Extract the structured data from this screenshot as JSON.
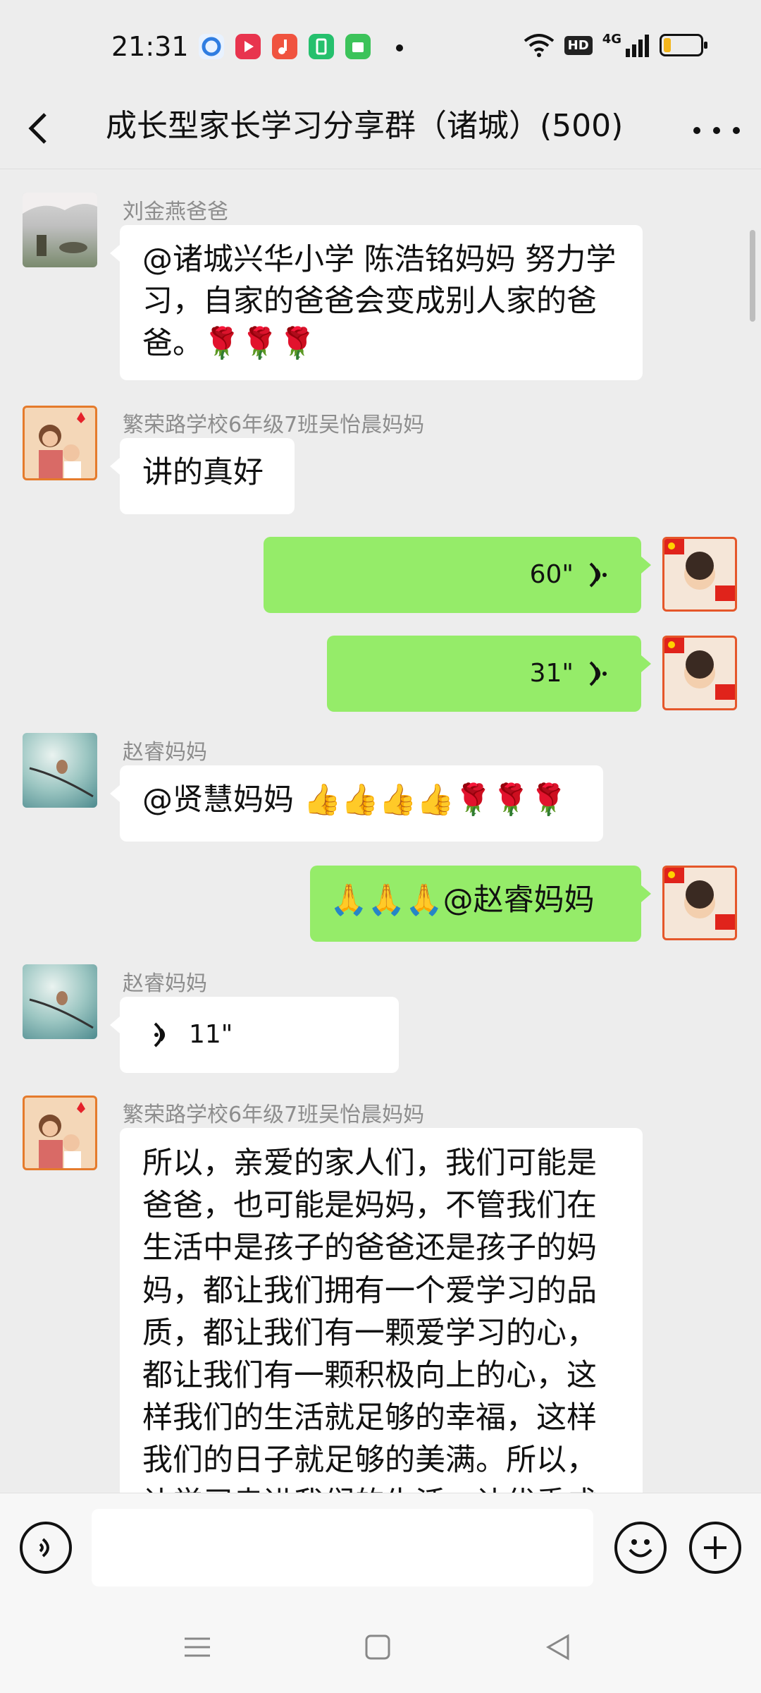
{
  "status_bar": {
    "time": "21:31",
    "network": "4G",
    "hd_label": "HD",
    "battery_percent": 20
  },
  "header": {
    "title": "成长型家长学习分享群（诸城）(500)"
  },
  "messages": [
    {
      "side": "left",
      "sender": "刘金燕爸爸",
      "text": "@诸城兴华小学  陈浩铭妈妈  努力学习，自家的爸爸会变成别人家的爸爸。🌹🌹🌹"
    },
    {
      "side": "left",
      "sender": "繁荣路学校6年级7班吴怡晨妈妈",
      "text": "讲的真好"
    },
    {
      "side": "right",
      "type": "voice",
      "duration": "60\""
    },
    {
      "side": "right",
      "type": "voice",
      "duration": "31\""
    },
    {
      "side": "left",
      "sender": "赵睿妈妈",
      "text": "@贤慧妈妈  👍👍👍👍🌹🌹🌹"
    },
    {
      "side": "right",
      "text": "🙏🙏🙏@赵睿妈妈"
    },
    {
      "side": "left",
      "sender": "赵睿妈妈",
      "type": "voice",
      "duration": "11\""
    },
    {
      "side": "left",
      "sender": "繁荣路学校6年级7班吴怡晨妈妈",
      "text": "所以，亲爱的家人们，我们可能是爸爸，也可能是妈妈，不管我们在生活中是孩子的爸爸还是孩子的妈妈，都让我们拥有一个爱学习的品质，都让我们有一颗爱学习的心，都让我们有一颗积极向上的心，这样我们的生活就足够的幸福，这样我们的日子就足够的美满。所以，让学习走进我们的生活，让优秀成"
    }
  ],
  "input": {
    "placeholder": ""
  },
  "colors": {
    "bubble_right": "#95ec69",
    "bubble_left": "#ffffff",
    "background": "#ededed"
  },
  "icons": [
    "back-arrow-icon",
    "more-icon",
    "voice-input-icon",
    "emoji-icon",
    "plus-icon",
    "menu-icon",
    "home-icon",
    "back-nav-icon"
  ]
}
